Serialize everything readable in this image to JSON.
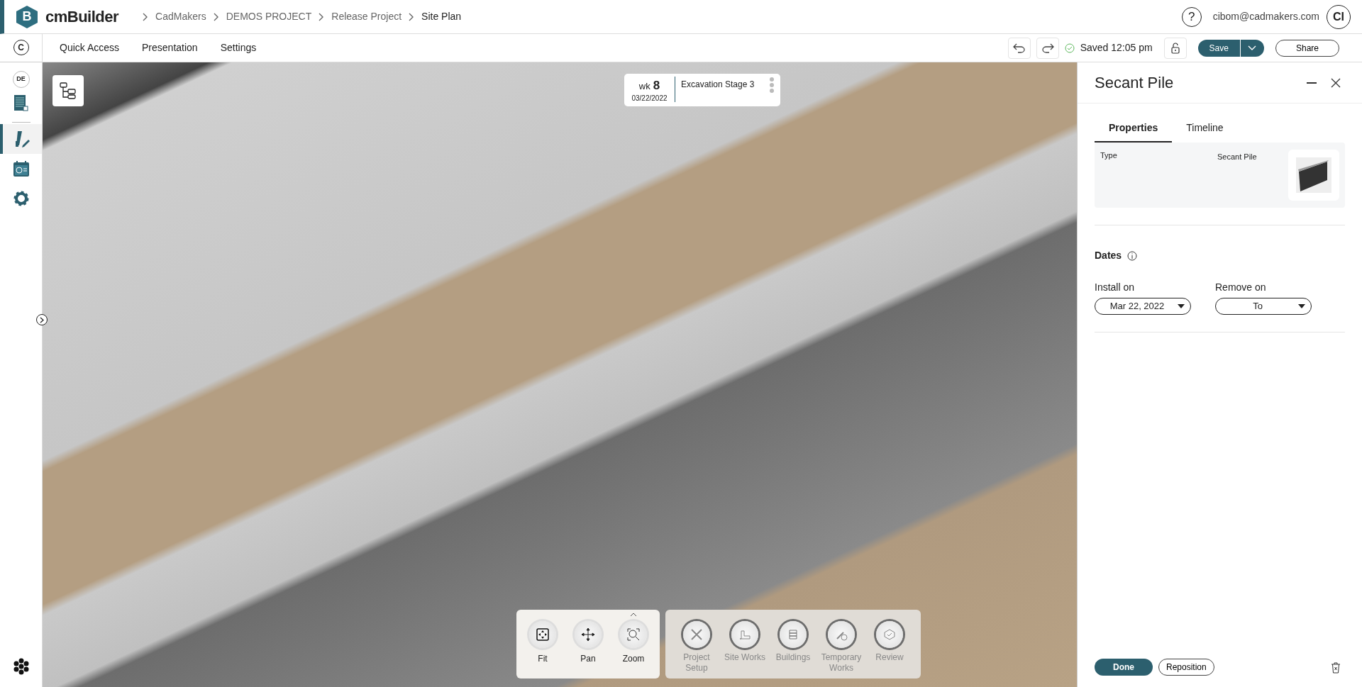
{
  "app": {
    "logo_letter": "B",
    "name": "cmBuilder"
  },
  "breadcrumbs": [
    {
      "label": "CadMakers",
      "current": false
    },
    {
      "label": "DEMOS PROJECT",
      "current": false
    },
    {
      "label": "Release Project",
      "current": false
    },
    {
      "label": "Site Plan",
      "current": true
    }
  ],
  "user": {
    "help": "?",
    "email": "cibom@cadmakers.com",
    "initials": "CI"
  },
  "menu": [
    "Quick Access",
    "Presentation",
    "Settings"
  ],
  "toolbar": {
    "saved": "Saved 12:05 pm",
    "save": "Save",
    "share": "Share"
  },
  "sidebar": {
    "company": "C",
    "project": "DE",
    "items": [
      {
        "kind": "document",
        "selected": false
      },
      {
        "kind": "design",
        "selected": true
      },
      {
        "kind": "schedule",
        "selected": false
      },
      {
        "kind": "settings",
        "selected": false
      }
    ]
  },
  "stage": {
    "wk_label": "wk",
    "week": "8",
    "date": "03/22/2022",
    "name": "Excavation Stage 3"
  },
  "view_tools": [
    {
      "kind": "fit",
      "label": "Fit"
    },
    {
      "kind": "pan",
      "label": "Pan"
    },
    {
      "kind": "zoom",
      "label": "Zoom"
    }
  ],
  "workflow": [
    {
      "kind": "setup",
      "label": "Project Setup"
    },
    {
      "kind": "site",
      "label": "Site Works"
    },
    {
      "kind": "buildings",
      "label": "Buildings"
    },
    {
      "kind": "temporary",
      "label": "Temporary Works"
    },
    {
      "kind": "review",
      "label": "Review"
    }
  ],
  "panel": {
    "title": "Secant Pile",
    "tabs": [
      {
        "label": "Properties",
        "selected": true
      },
      {
        "label": "Timeline",
        "selected": false
      }
    ],
    "properties": [
      {
        "label": "Type",
        "value": "Secant Pile"
      }
    ],
    "dates_title": "Dates",
    "date_fields": [
      {
        "label": "Install on",
        "value": "Mar 22, 2022"
      },
      {
        "label": "Remove on",
        "value": "To"
      }
    ],
    "buttons": {
      "done": "Done",
      "reposition": "Reposition"
    }
  }
}
